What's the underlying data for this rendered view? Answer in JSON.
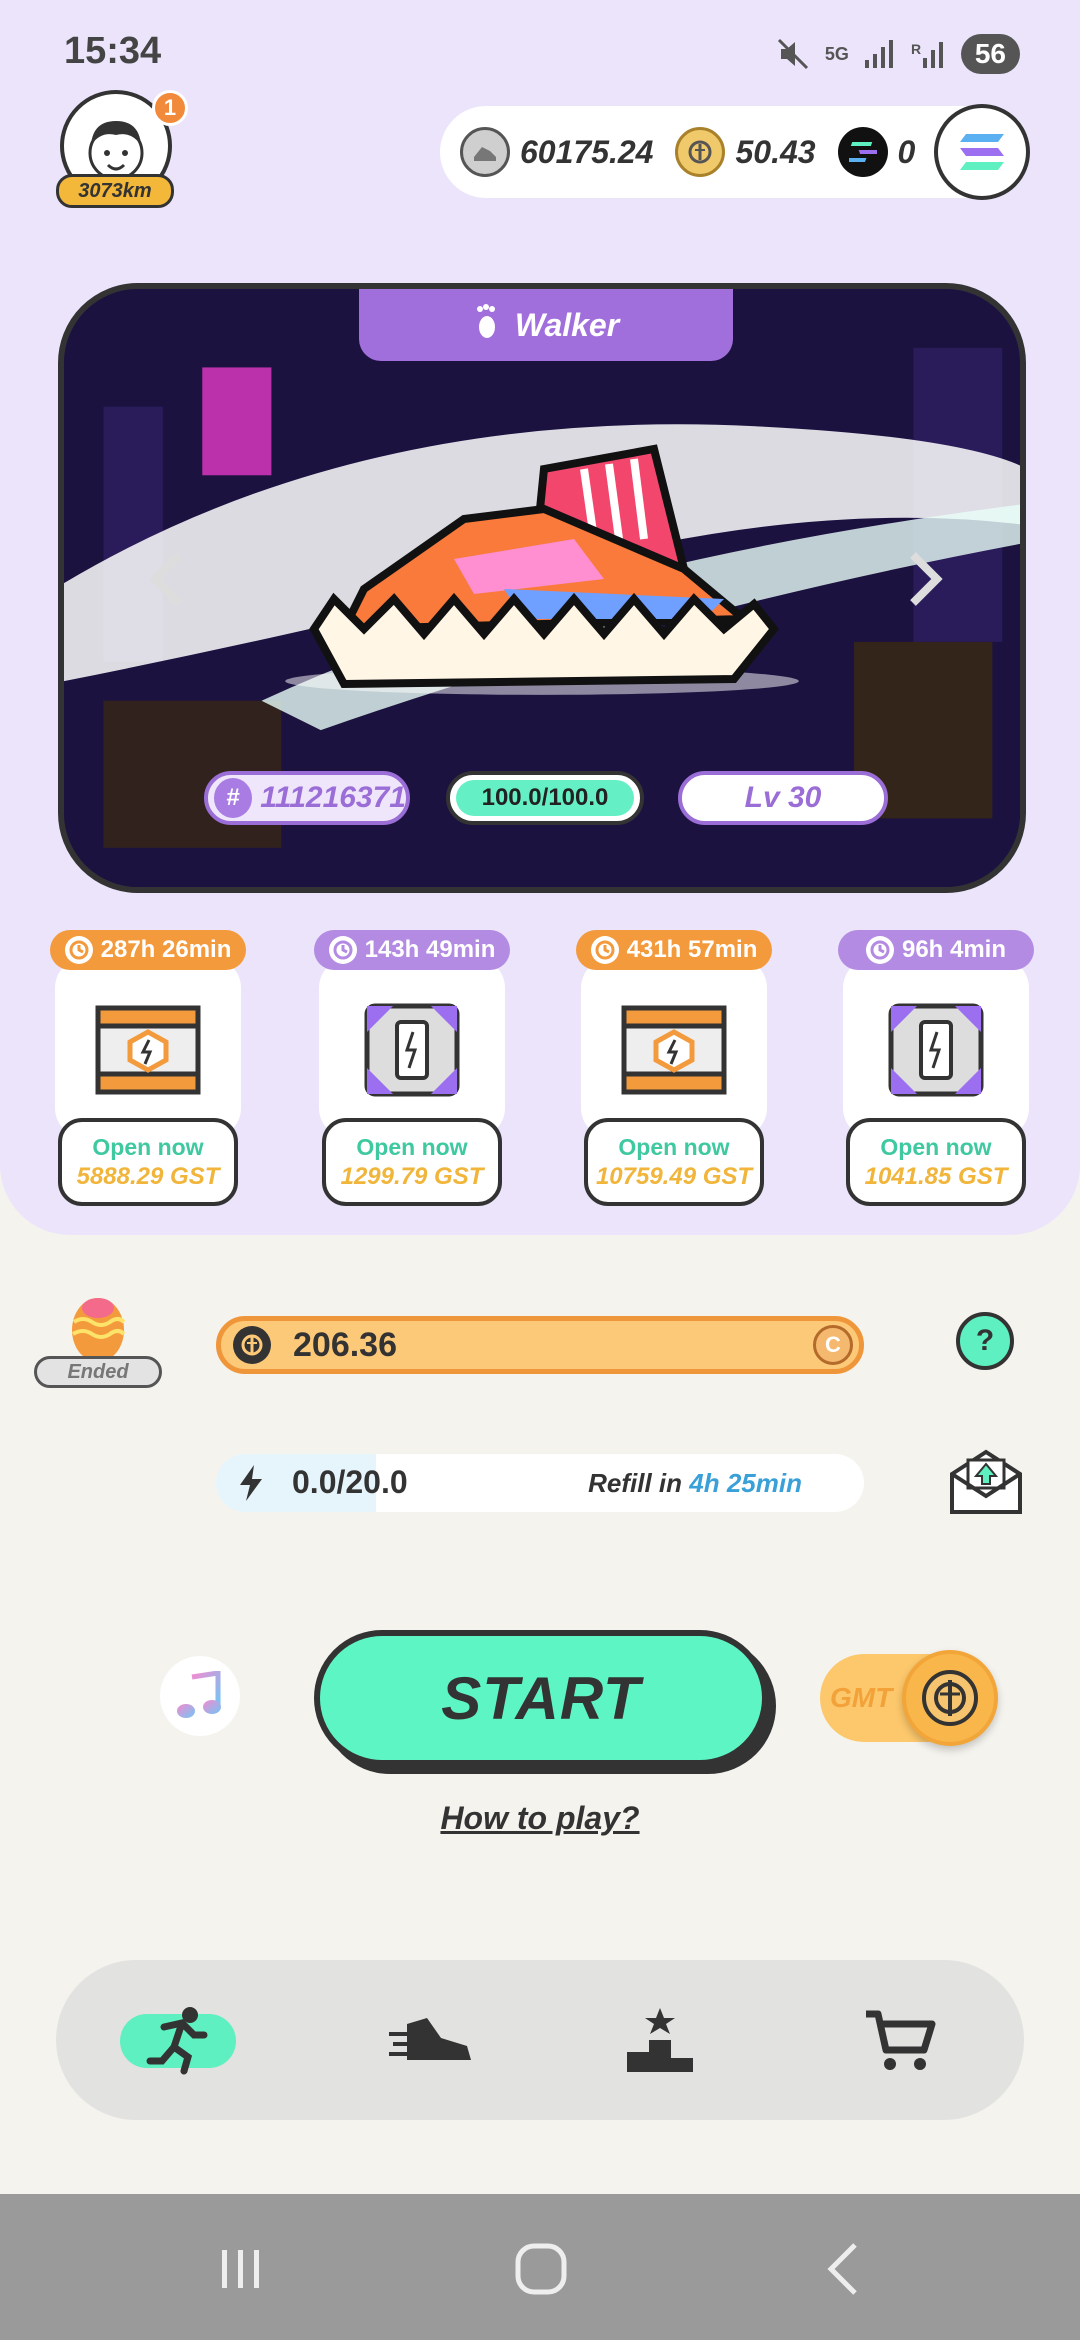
{
  "status_bar": {
    "time": "15:34",
    "network": "5G",
    "battery": "56"
  },
  "profile": {
    "notification_count": "1",
    "distance": "3073km"
  },
  "balances": {
    "gst_gmt_token": "60175.24",
    "gst": "50.43",
    "sol": "0"
  },
  "sneaker": {
    "type": "Walker",
    "id": "111216371",
    "durability": "100.0/100.0",
    "level": "Lv 30"
  },
  "mystery_boxes": [
    {
      "timer": "287h 26min",
      "open_label": "Open now",
      "price": "5888.29 GST",
      "color": "#f39a3d"
    },
    {
      "timer": "143h 49min",
      "open_label": "Open now",
      "price": "1299.79 GST",
      "color": "#b38be3"
    },
    {
      "timer": "431h 57min",
      "open_label": "Open now",
      "price": "10759.49 GST",
      "color": "#f39a3d"
    },
    {
      "timer": "96h 4min",
      "open_label": "Open now",
      "price": "1041.85 GST",
      "color": "#b38be3"
    }
  ],
  "egg": {
    "status": "Ended"
  },
  "gst_bar": {
    "value": "206.36",
    "cap_label": "C"
  },
  "help": {
    "label": "?"
  },
  "energy": {
    "value": "0.0/20.0",
    "refill_label": "Refill in",
    "refill_time": "4h 25min"
  },
  "start": {
    "label": "START",
    "toggle_label": "GMT",
    "how_to_play": "How to play?"
  },
  "colors": {
    "accent_mint": "#5ef0c0",
    "accent_purple": "#a06fdc",
    "accent_orange": "#f39a3d",
    "gst_gold": "#f0b53a"
  },
  "icons": {
    "nav": [
      "run-icon",
      "sneaker-icon",
      "leaderboard-icon",
      "cart-icon"
    ],
    "system_nav": [
      "recent-apps-icon",
      "home-icon",
      "back-icon"
    ]
  }
}
